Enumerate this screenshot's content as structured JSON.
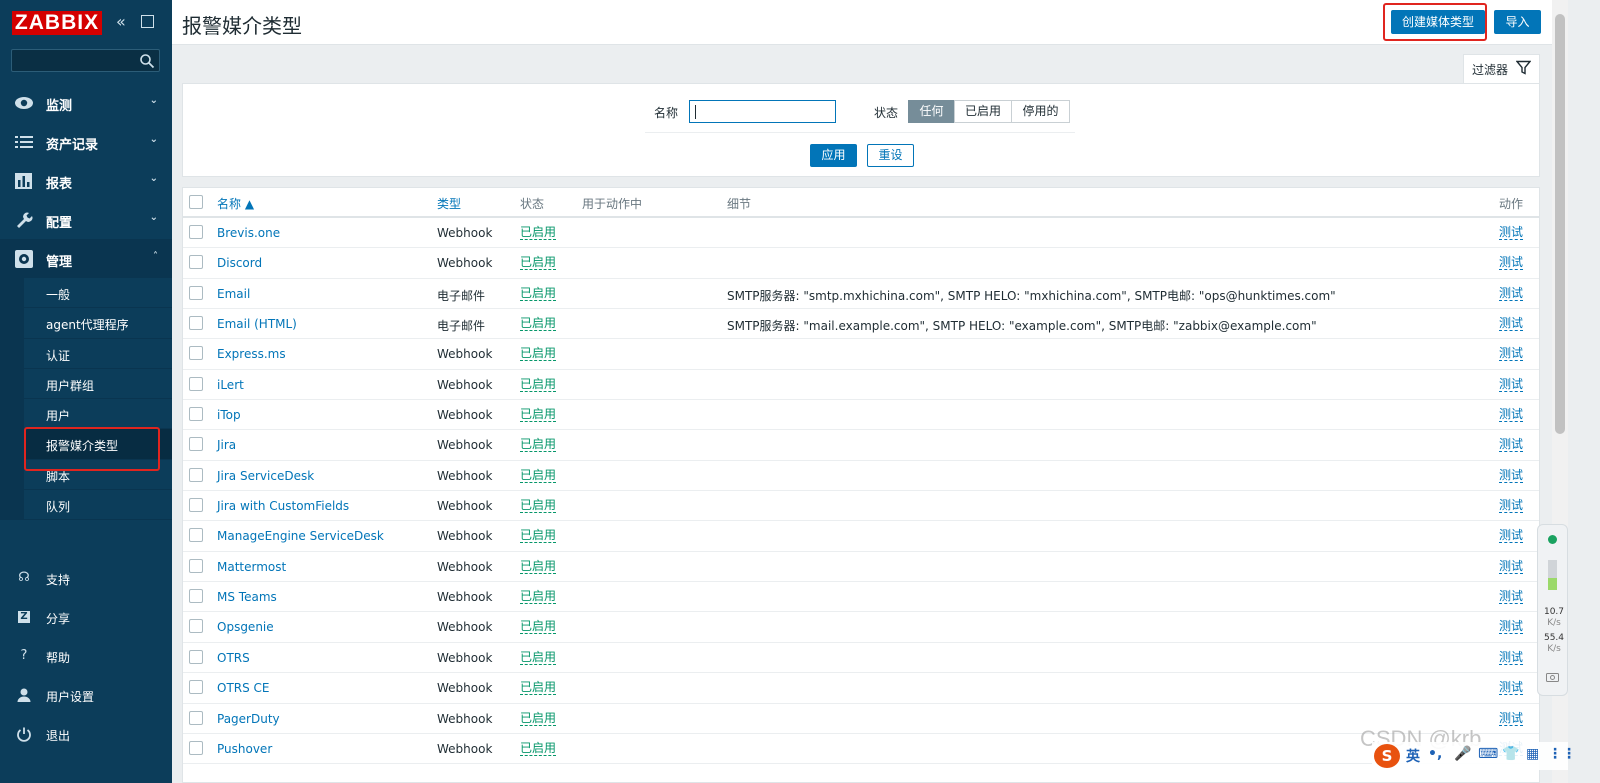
{
  "app": {
    "logo": "ZABBIX"
  },
  "sidebar": {
    "main": [
      {
        "label": "监测",
        "icon": "eye-icon"
      },
      {
        "label": "资产记录",
        "icon": "list-icon"
      },
      {
        "label": "报表",
        "icon": "chart-icon"
      },
      {
        "label": "配置",
        "icon": "wrench-icon"
      },
      {
        "label": "管理",
        "icon": "gear-icon"
      }
    ],
    "admin_sub": [
      "一般",
      "agent代理程序",
      "认证",
      "用户群组",
      "用户",
      "报警媒介类型",
      "脚本",
      "队列"
    ],
    "bottom": [
      {
        "label": "支持",
        "icon": "headset-icon"
      },
      {
        "label": "分享",
        "icon": "share-icon"
      },
      {
        "label": "帮助",
        "icon": "help-icon"
      },
      {
        "label": "用户设置",
        "icon": "user-icon"
      },
      {
        "label": "退出",
        "icon": "power-icon"
      }
    ]
  },
  "header": {
    "title": "报警媒介类型",
    "create_button": "创建媒体类型",
    "import_button": "导入"
  },
  "filter": {
    "tab_label": "过滤器",
    "name_label": "名称",
    "name_value": "",
    "status_label": "状态",
    "status_options": [
      "任何",
      "已启用",
      "停用的"
    ],
    "status_selected": "任何",
    "apply": "应用",
    "reset": "重设"
  },
  "table": {
    "columns": [
      "名称 ▲",
      "类型",
      "状态",
      "用于动作中",
      "细节",
      "动作"
    ],
    "rows": [
      {
        "name": "Brevis.one",
        "type": "Webhook",
        "status": "已启用",
        "details": "",
        "action": "测试"
      },
      {
        "name": "Discord",
        "type": "Webhook",
        "status": "已启用",
        "details": "",
        "action": "测试"
      },
      {
        "name": "Email",
        "type": "电子邮件",
        "status": "已启用",
        "details": "SMTP服务器: \"smtp.mxhichina.com\", SMTP HELO: \"mxhichina.com\", SMTP电邮: \"ops@hunktimes.com\"",
        "action": "测试"
      },
      {
        "name": "Email (HTML)",
        "type": "电子邮件",
        "status": "已启用",
        "details": "SMTP服务器: \"mail.example.com\", SMTP HELO: \"example.com\", SMTP电邮: \"zabbix@example.com\"",
        "action": "测试"
      },
      {
        "name": "Express.ms",
        "type": "Webhook",
        "status": "已启用",
        "details": "",
        "action": "测试"
      },
      {
        "name": "iLert",
        "type": "Webhook",
        "status": "已启用",
        "details": "",
        "action": "测试"
      },
      {
        "name": "iTop",
        "type": "Webhook",
        "status": "已启用",
        "details": "",
        "action": "测试"
      },
      {
        "name": "Jira",
        "type": "Webhook",
        "status": "已启用",
        "details": "",
        "action": "测试"
      },
      {
        "name": "Jira ServiceDesk",
        "type": "Webhook",
        "status": "已启用",
        "details": "",
        "action": "测试"
      },
      {
        "name": "Jira with CustomFields",
        "type": "Webhook",
        "status": "已启用",
        "details": "",
        "action": "测试"
      },
      {
        "name": "ManageEngine ServiceDesk",
        "type": "Webhook",
        "status": "已启用",
        "details": "",
        "action": "测试"
      },
      {
        "name": "Mattermost",
        "type": "Webhook",
        "status": "已启用",
        "details": "",
        "action": "测试"
      },
      {
        "name": "MS Teams",
        "type": "Webhook",
        "status": "已启用",
        "details": "",
        "action": "测试"
      },
      {
        "name": "Opsgenie",
        "type": "Webhook",
        "status": "已启用",
        "details": "",
        "action": "测试"
      },
      {
        "name": "OTRS",
        "type": "Webhook",
        "status": "已启用",
        "details": "",
        "action": "测试"
      },
      {
        "name": "OTRS CE",
        "type": "Webhook",
        "status": "已启用",
        "details": "",
        "action": "测试"
      },
      {
        "name": "PagerDuty",
        "type": "Webhook",
        "status": "已启用",
        "details": "",
        "action": "测试"
      },
      {
        "name": "Pushover",
        "type": "Webhook",
        "status": "已启用",
        "details": "",
        "action": "测试"
      }
    ]
  },
  "net_widget": {
    "up": "10.7",
    "down": "55.4",
    "unit": "K/s"
  },
  "watermark": "CSDN @krb",
  "ime": {
    "lang": "英"
  },
  "colors": {
    "sidebar": "#0c3d5a",
    "accent": "#0275b8",
    "enabled": "#059669",
    "highlight": "#e0251f"
  }
}
